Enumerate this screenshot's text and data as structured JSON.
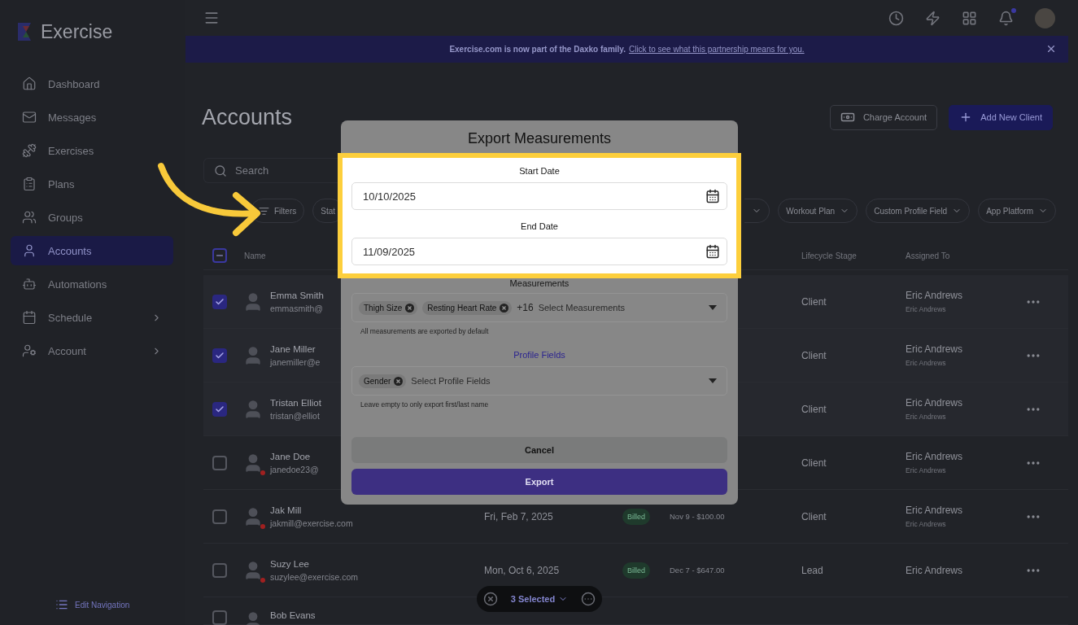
{
  "brand": "Exercise",
  "sidebar": {
    "items": [
      {
        "label": "Dashboard",
        "selected": false,
        "expandable": false
      },
      {
        "label": "Messages",
        "selected": false,
        "expandable": false
      },
      {
        "label": "Exercises",
        "selected": false,
        "expandable": false
      },
      {
        "label": "Plans",
        "selected": false,
        "expandable": false
      },
      {
        "label": "Groups",
        "selected": false,
        "expandable": false
      },
      {
        "label": "Accounts",
        "selected": true,
        "expandable": false
      },
      {
        "label": "Automations",
        "selected": false,
        "expandable": false
      },
      {
        "label": "Schedule",
        "selected": false,
        "expandable": true
      },
      {
        "label": "Account",
        "selected": false,
        "expandable": true
      }
    ],
    "footer": "Edit Navigation"
  },
  "topbar": {
    "notifications_unread": true
  },
  "banner": {
    "message": "Exercise.com is now part of the Daxko family.",
    "link": "Click to see what this partnership means for you."
  },
  "page": {
    "title": "Accounts",
    "actions": [
      {
        "label": "Charge Account",
        "kind": "outline"
      },
      {
        "label": "Add New Client",
        "kind": "primary"
      }
    ]
  },
  "search": {
    "placeholder": "Search"
  },
  "filters": [
    {
      "label": "Filters",
      "kind": "filter"
    },
    {
      "label": "Stat",
      "kind": "plain"
    },
    {
      "label": "Workout Plan",
      "kind": "dropdown"
    },
    {
      "label": "Custom Profile Field",
      "kind": "dropdown"
    },
    {
      "label": "App Platform",
      "kind": "dropdown"
    }
  ],
  "table": {
    "columns": [
      "Name",
      "Lifecycle Stage",
      "Assigned To"
    ],
    "partially_selected": true,
    "rows": [
      {
        "name": "Emma Smith",
        "email": "emmasmith@",
        "selected": true,
        "alert": false,
        "lifecycle": "Client",
        "assigned_to": "Eric Andrews",
        "assigned_sub": "Eric Andrews"
      },
      {
        "name": "Jane Miller",
        "email": "janemiller@e",
        "selected": true,
        "alert": false,
        "lifecycle": "Client",
        "assigned_to": "Eric Andrews",
        "assigned_sub": "Eric Andrews"
      },
      {
        "name": "Tristan Elliot",
        "email": "tristan@elliot",
        "selected": true,
        "alert": false,
        "lifecycle": "Client",
        "assigned_to": "Eric Andrews",
        "assigned_sub": "Eric Andrews"
      },
      {
        "name": "Jane Doe",
        "email": "janedoe23@",
        "selected": false,
        "alert": true,
        "lifecycle": "Client",
        "assigned_to": "Eric Andrews",
        "assigned_sub": "Eric Andrews"
      },
      {
        "name": "Jak Mill",
        "email": "jakmill@exercise.com",
        "selected": false,
        "alert": true,
        "last_date": "Fri, Feb 7, 2025",
        "billing": "Billed",
        "next_payment": "Nov 9 - $100.00",
        "lifecycle": "Client",
        "assigned_to": "Eric Andrews",
        "assigned_sub": "Eric Andrews"
      },
      {
        "name": "Suzy Lee",
        "email": "suzylee@exercise.com",
        "selected": false,
        "alert": true,
        "last_date": "Mon, Oct 6, 2025",
        "billing": "Billed",
        "next_payment": "Dec 7 - $647.00",
        "lifecycle": "Lead",
        "assigned_to": "Eric Andrews"
      },
      {
        "name": "Bob Evans",
        "selected": false
      }
    ]
  },
  "selection_bar": {
    "label": "3 Selected"
  },
  "modal": {
    "title": "Export Measurements",
    "dates": [
      {
        "label": "Start Date",
        "value": "10/10/2025"
      },
      {
        "label": "End Date",
        "value": "11/09/2025"
      }
    ],
    "selects": [
      {
        "label": "Measurements",
        "accent": false,
        "chips": [
          "Thigh Size",
          "Resting Heart Rate"
        ],
        "more": "+16",
        "placeholder": "Select Measurements",
        "hint": "All measurements are exported by default"
      },
      {
        "label": "Profile Fields",
        "accent": true,
        "chips": [
          "Gender"
        ],
        "placeholder": "Select Profile Fields",
        "hint": "Leave empty to only export first/last name"
      }
    ],
    "buttons": [
      {
        "label": "Cancel",
        "kind": "secondary"
      },
      {
        "label": "Export",
        "kind": "primary"
      }
    ]
  }
}
